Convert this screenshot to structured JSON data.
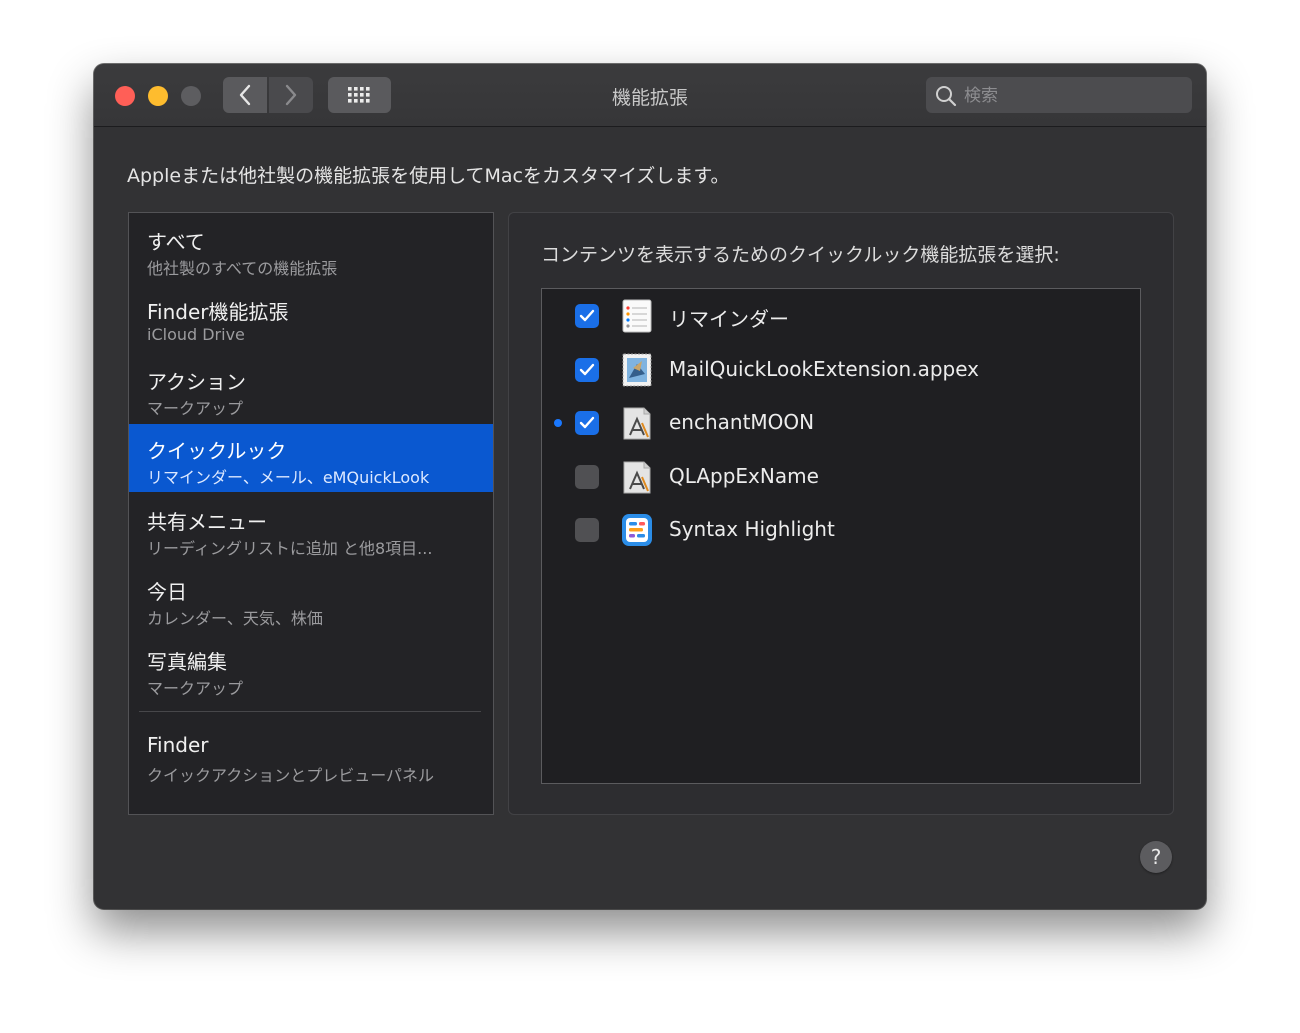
{
  "window": {
    "title": "機能拡張",
    "search_placeholder": "検索"
  },
  "description": "Appleまたは他社製の機能拡張を使用してMacをカスタマイズします。",
  "sidebar": {
    "items": [
      {
        "title": "すべて",
        "subtitle": "他社製のすべての機能拡張"
      },
      {
        "title": "Finder機能拡張",
        "subtitle": "iCloud Drive"
      },
      {
        "title": "アクション",
        "subtitle": "マークアップ"
      },
      {
        "title": "クイックルック",
        "subtitle": "リマインダー、メール、eMQuickLook",
        "selected": true
      },
      {
        "title": "共有メニュー",
        "subtitle": "リーディングリストに追加 と他8項目..."
      },
      {
        "title": "今日",
        "subtitle": "カレンダー、天気、株価"
      },
      {
        "title": "写真編集",
        "subtitle": "マークアップ"
      },
      {
        "title": "Finder",
        "subtitle": "クイックアクションとプレビューパネル"
      }
    ]
  },
  "panel": {
    "heading": "コンテンツを表示するためのクイックルック機能拡張を選択:",
    "extensions": [
      {
        "name": "リマインダー",
        "checked": true,
        "icon": "reminders-icon"
      },
      {
        "name": "MailQuickLookExtension.appex",
        "checked": true,
        "icon": "mail-stamp-icon"
      },
      {
        "name": "enchantMOON",
        "checked": true,
        "icon": "app-generic-icon",
        "new": true
      },
      {
        "name": "QLAppExName",
        "checked": false,
        "icon": "app-generic-icon"
      },
      {
        "name": "Syntax Highlight",
        "checked": false,
        "icon": "syntax-highlight-icon"
      }
    ]
  },
  "help_label": "?",
  "colors": {
    "accent": "#0a58d0",
    "checkbox_checked": "#1a6fe8",
    "window_bg": "#323234"
  }
}
